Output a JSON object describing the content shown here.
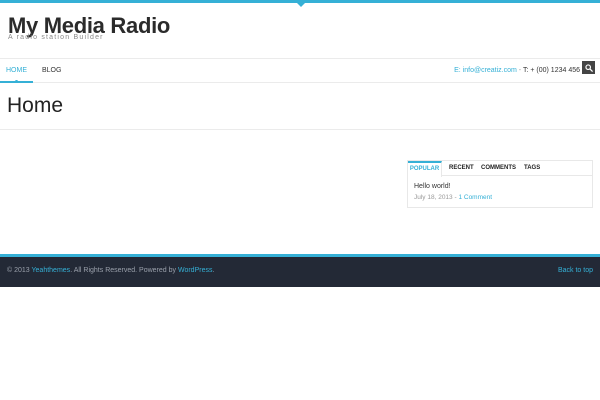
{
  "site": {
    "title": "My Media Radio",
    "tagline": "A radio station Builder"
  },
  "nav": {
    "items": [
      {
        "label": "HOME"
      },
      {
        "label": "BLOG"
      }
    ]
  },
  "contact": {
    "email_label": "E:",
    "email": "info@creatiz.com",
    "separator": " - ",
    "phone_label": "T:",
    "phone": "+ (00) 1234 456"
  },
  "page": {
    "title": "Home"
  },
  "widget": {
    "tabs": [
      {
        "label": "POPULAR"
      },
      {
        "label": "RECENT"
      },
      {
        "label": "COMMENTS"
      },
      {
        "label": "TAGS"
      }
    ],
    "post": {
      "title": "Hello world!",
      "date": "July 18, 2013",
      "meta_sep": " - ",
      "comments": "1 Comment"
    }
  },
  "footer": {
    "copyright": "© 2013",
    "brand": "Yeahthemes",
    "rights": ". All Rights Reserved. Powered by",
    "powered": "WordPress",
    "period": ".",
    "back_to_top": "Back to top"
  },
  "colors": {
    "accent": "#35b0d6",
    "footer_bg": "#232936"
  }
}
